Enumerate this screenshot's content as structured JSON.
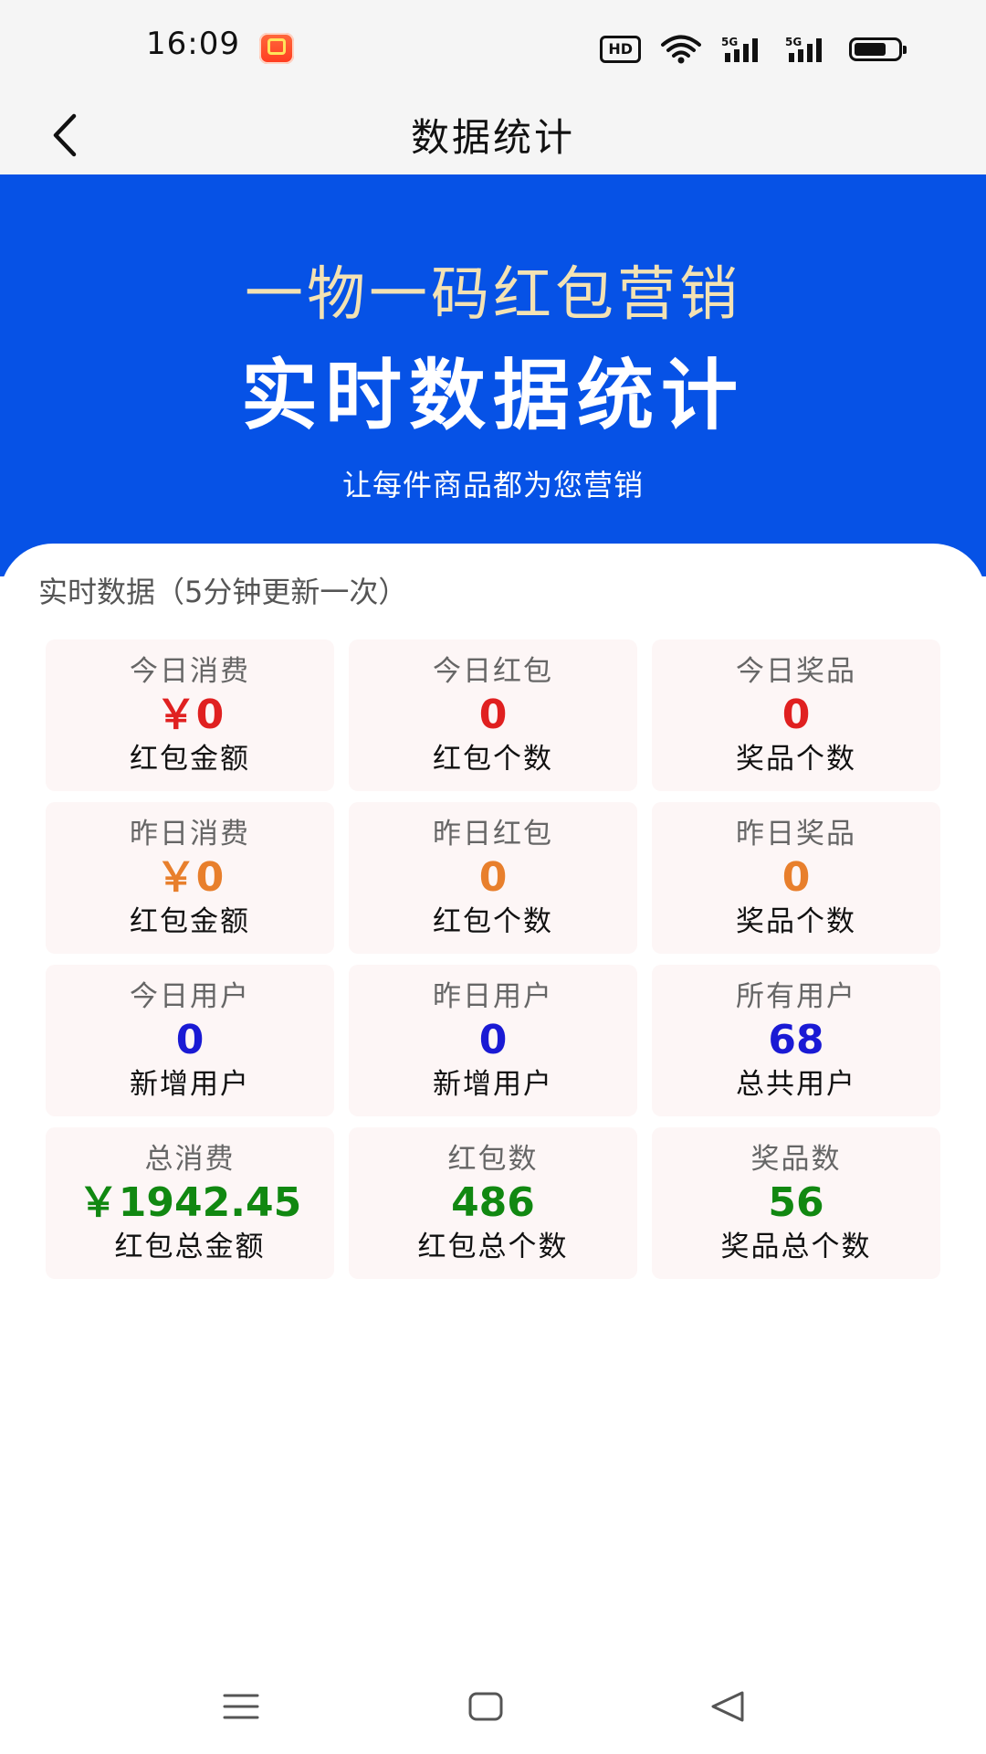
{
  "status_bar": {
    "time": "16:09",
    "app_icon": "taobao-app-icon",
    "hd_label": "HD",
    "network_label": "5G"
  },
  "nav": {
    "title": "数据统计",
    "back_icon": "chevron-left-icon"
  },
  "hero": {
    "line1": "一物一码红包营销",
    "line2": "实时数据统计",
    "line3": "让每件商品都为您营销",
    "background": "#0652e6",
    "line1_color": "#f3e2b3"
  },
  "stats": {
    "section_title": "实时数据（5分钟更新一次）",
    "colors": {
      "red": "#e02020",
      "orange": "#e87f2c",
      "blue": "#1a1ad4",
      "green": "#118811"
    },
    "cards": [
      {
        "title": "今日消费",
        "value": "￥0",
        "sub": "红包金额",
        "color": "red"
      },
      {
        "title": "今日红包",
        "value": "0",
        "sub": "红包个数",
        "color": "red"
      },
      {
        "title": "今日奖品",
        "value": "0",
        "sub": "奖品个数",
        "color": "red"
      },
      {
        "title": "昨日消费",
        "value": "￥0",
        "sub": "红包金额",
        "color": "orange"
      },
      {
        "title": "昨日红包",
        "value": "0",
        "sub": "红包个数",
        "color": "orange"
      },
      {
        "title": "昨日奖品",
        "value": "0",
        "sub": "奖品个数",
        "color": "orange"
      },
      {
        "title": "今日用户",
        "value": "0",
        "sub": "新增用户",
        "color": "blue"
      },
      {
        "title": "昨日用户",
        "value": "0",
        "sub": "新增用户",
        "color": "blue"
      },
      {
        "title": "所有用户",
        "value": "68",
        "sub": "总共用户",
        "color": "blue"
      },
      {
        "title": "总消费",
        "value": "￥1942.45",
        "sub": "红包总金额",
        "color": "green"
      },
      {
        "title": "红包数",
        "value": "486",
        "sub": "红包总个数",
        "color": "green"
      },
      {
        "title": "奖品数",
        "value": "56",
        "sub": "奖品总个数",
        "color": "green"
      }
    ]
  },
  "system_nav": {
    "menu_icon": "menu-icon",
    "home_icon": "home-square-icon",
    "back_icon": "back-triangle-icon"
  }
}
